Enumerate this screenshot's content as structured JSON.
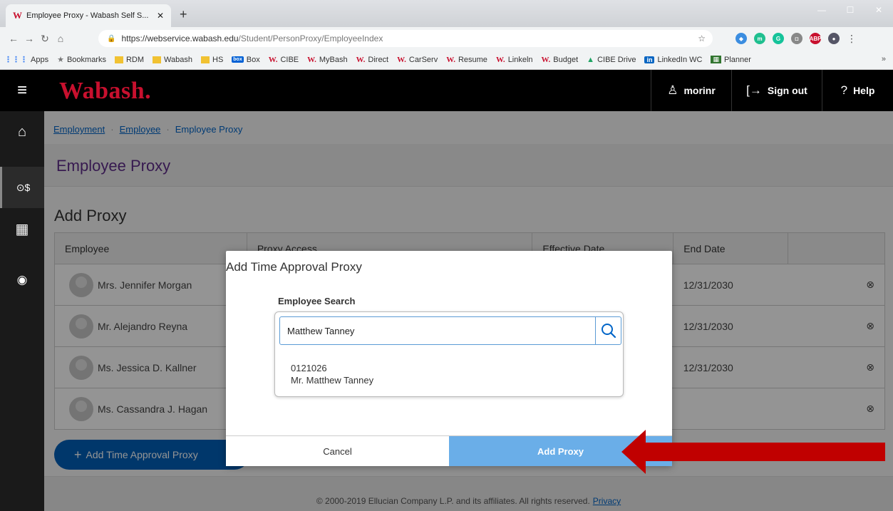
{
  "browser": {
    "tab_title": "Employee Proxy - Wabash Self S...",
    "tab_favicon": "W",
    "new_tab": "+",
    "url_host": "https://webservice.wabash.edu",
    "url_path": "/Student/PersonProxy/EmployeeIndex",
    "bookmarks": [
      {
        "label": "Apps",
        "icon": "apps"
      },
      {
        "label": "Bookmarks",
        "icon": "star"
      },
      {
        "label": "RDM",
        "icon": "folder"
      },
      {
        "label": "Wabash",
        "icon": "folder"
      },
      {
        "label": "HS",
        "icon": "hs"
      },
      {
        "label": "Box",
        "icon": "box"
      },
      {
        "label": "CIBE",
        "icon": "w"
      },
      {
        "label": "MyBash",
        "icon": "w"
      },
      {
        "label": "Direct",
        "icon": "w"
      },
      {
        "label": "CarServ",
        "icon": "w"
      },
      {
        "label": "Resume",
        "icon": "w"
      },
      {
        "label": "Linkeln",
        "icon": "w"
      },
      {
        "label": "Budget",
        "icon": "w"
      },
      {
        "label": "CIBE Drive",
        "icon": "drive"
      },
      {
        "label": "LinkedIn WC",
        "icon": "in"
      },
      {
        "label": "Planner",
        "icon": "planner"
      }
    ],
    "bookmarks_more": "»"
  },
  "header": {
    "logo": "Wabash.",
    "user": "morinr",
    "sign_out": "Sign out",
    "help": "Help"
  },
  "breadcrumb": {
    "item1": "Employment",
    "item2": "Employee",
    "current": "Employee Proxy"
  },
  "page_title": "Employee Proxy",
  "add_proxy_heading": "Add Proxy",
  "table": {
    "headers": [
      "Employee",
      "Proxy Access",
      "Effective Date",
      "End Date",
      ""
    ],
    "rows": [
      {
        "name": "Mrs. Jennifer Morgan",
        "end_date": "12/31/2030"
      },
      {
        "name": "Mr. Alejandro Reyna",
        "end_date": "12/31/2030"
      },
      {
        "name": "Ms. Jessica D. Kallner",
        "end_date": "12/31/2030"
      },
      {
        "name": "Ms. Cassandra J. Hagan",
        "end_date": ""
      }
    ]
  },
  "add_button": "Add Time Approval Proxy",
  "footer": {
    "copyright": "© 2000-2019 Ellucian Company L.P. and its affiliates. All rights reserved.",
    "privacy": "Privacy"
  },
  "dialog": {
    "title": "Add Time Approval Proxy",
    "search_label": "Employee Search",
    "search_value": "Matthew Tanney",
    "result_id": "0121026",
    "result_name": "Mr. Matthew Tanney",
    "cancel": "Cancel",
    "add_proxy": "Add Proxy"
  },
  "colors": {
    "brand_red": "#c8102e",
    "title_purple": "#5f2d8b",
    "primary_blue": "#005fb8",
    "add_proxy_blue": "#6aaee8",
    "arrow_red": "#c00000"
  }
}
